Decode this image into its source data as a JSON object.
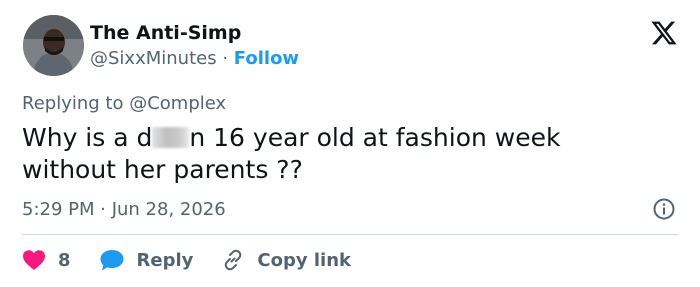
{
  "author": {
    "name": "The Anti-Simp",
    "handle": "@SixxMinutes",
    "separator": "·",
    "follow_label": "Follow"
  },
  "reply_context": {
    "prefix": "Replying to",
    "mention": "@Complex"
  },
  "tweet": {
    "text_before_redaction": "Why is a d",
    "text_after_redaction": "n 16 year old at fashion week",
    "text_line2": "without her parents ??"
  },
  "meta": {
    "timestamp": "5:29 PM · Jun 28, 2026"
  },
  "actions": {
    "like_count": "8",
    "reply_label": "Reply",
    "copy_link_label": "Copy link"
  },
  "icons": {
    "like": "heart-icon",
    "reply": "chat-bubble-icon",
    "copy_link": "link-icon",
    "info": "info-icon",
    "brand": "x-logo-icon"
  },
  "colors": {
    "accent": "#1d9bf0",
    "like": "#f91880",
    "secondary_text": "#536471",
    "primary_text": "#0f1419"
  }
}
